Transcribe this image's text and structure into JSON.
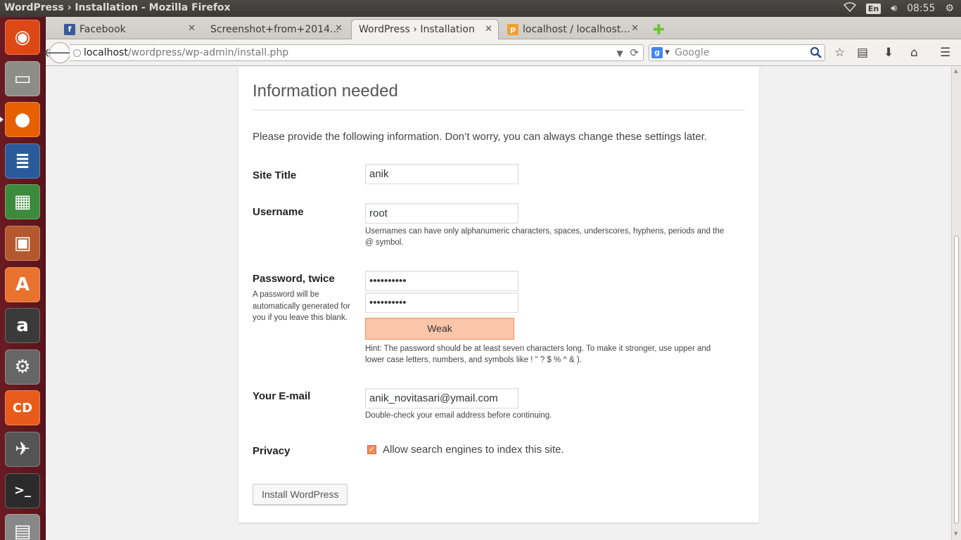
{
  "window": {
    "title": "WordPress › Installation - Mozilla Firefox"
  },
  "panel": {
    "language": "En",
    "clock": "08:55"
  },
  "launcher": {
    "items": [
      {
        "name": "ubuntu-dash-icon",
        "glyph": "◉",
        "color": "#dd4814"
      },
      {
        "name": "files-icon",
        "glyph": "▭",
        "color": "#8d8d88"
      },
      {
        "name": "firefox-icon",
        "glyph": "●",
        "color": "#e66000"
      },
      {
        "name": "writer-icon",
        "glyph": "≣",
        "color": "#2a5a9a"
      },
      {
        "name": "calc-icon",
        "glyph": "▦",
        "color": "#3c8a3c"
      },
      {
        "name": "impress-icon",
        "glyph": "▣",
        "color": "#b5582e"
      },
      {
        "name": "software-center-icon",
        "glyph": "A",
        "color": "#e9722e"
      },
      {
        "name": "amazon-icon",
        "glyph": "a",
        "color": "#3a3a3a"
      },
      {
        "name": "system-settings-icon",
        "glyph": "⚙",
        "color": "#666"
      },
      {
        "name": "cd-burner-icon",
        "glyph": "CD",
        "color": "#e85b1a"
      },
      {
        "name": "launcher-app-icon",
        "glyph": "✈",
        "color": "#555"
      },
      {
        "name": "terminal-icon",
        "glyph": ">_",
        "color": "#2b2b2b"
      },
      {
        "name": "workspaces-icon",
        "glyph": "▤",
        "color": "#888"
      }
    ]
  },
  "tabs": [
    {
      "label": "Facebook",
      "icon": "facebook-icon",
      "icon_glyph": "f",
      "icon_color": "#3b5998",
      "active": false
    },
    {
      "label": "Screenshot+from+2014...",
      "icon": "",
      "icon_glyph": "",
      "icon_color": "",
      "active": false
    },
    {
      "label": "WordPress › Installation",
      "icon": "",
      "icon_glyph": "",
      "icon_color": "",
      "active": true
    },
    {
      "label": "localhost / localhost...",
      "icon": "phpmyadmin-icon",
      "icon_glyph": "p",
      "icon_color": "#f0a030",
      "active": false
    }
  ],
  "nav": {
    "url_host": "localhost",
    "url_path": "/wordpress/wp-admin/install.php",
    "search_placeholder": "Google"
  },
  "form": {
    "heading": "Information needed",
    "intro": "Please provide the following information. Don’t worry, you can always change these settings later.",
    "site_title": {
      "label": "Site Title",
      "value": "anik"
    },
    "username": {
      "label": "Username",
      "value": "root",
      "desc": "Usernames can have only alphanumeric characters, spaces, underscores, hyphens, periods and the @ symbol."
    },
    "password": {
      "label": "Password, twice",
      "side_desc": "A password will be automatically generated for you if you leave this blank.",
      "value1": "••••••••••",
      "value2": "••••••••••",
      "strength": "Weak",
      "strength_color": "#fbc5a9",
      "hint": "Hint: The password should be at least seven characters long. To make it stronger, use upper and lower case letters, numbers, and symbols like ! \" ? $ % ^ & )."
    },
    "email": {
      "label": "Your E-mail",
      "value": "anik_novitasari@ymail.com",
      "desc": "Double-check your email address before continuing."
    },
    "privacy": {
      "label": "Privacy",
      "checkbox_label": "Allow search engines to index this site.",
      "checked": true
    },
    "submit_label": "Install WordPress"
  }
}
